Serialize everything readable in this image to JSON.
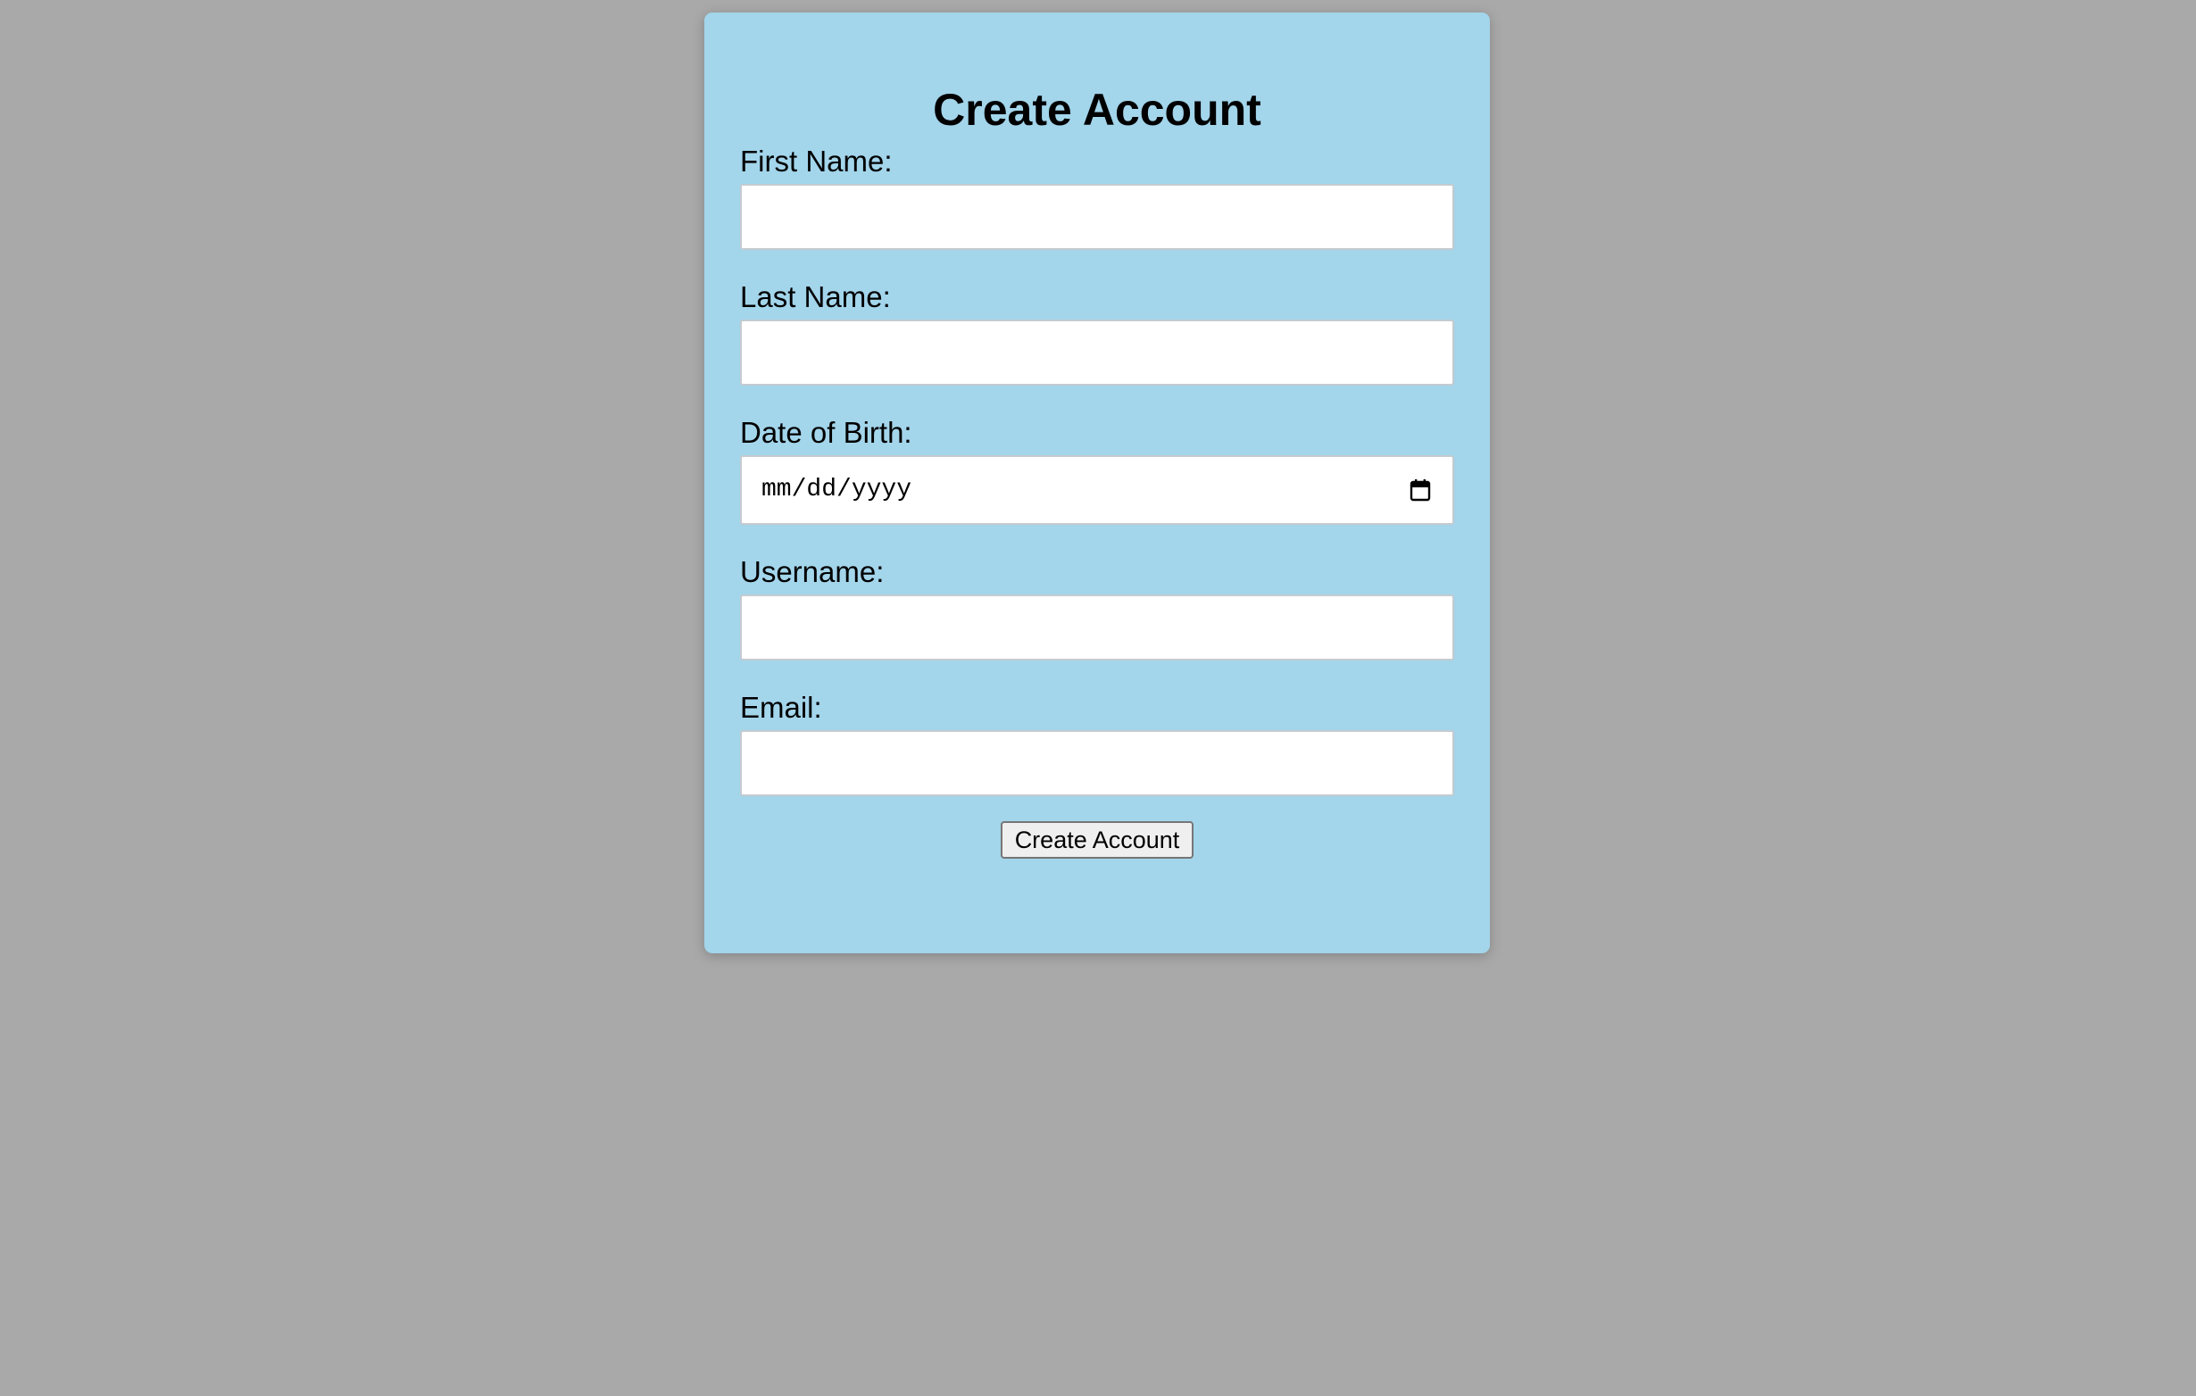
{
  "form": {
    "title": "Create Account",
    "fields": [
      {
        "label": "First Name:",
        "value": "",
        "placeholder": ""
      },
      {
        "label": "Last Name:",
        "value": "",
        "placeholder": ""
      },
      {
        "label": "Date of Birth:",
        "value": "mm/dd/yyyy",
        "icon": "calendar-icon"
      },
      {
        "label": "Username:",
        "value": "",
        "placeholder": ""
      },
      {
        "label": "Email:",
        "value": "",
        "placeholder": ""
      }
    ],
    "submit_label": "Create Account"
  },
  "colors": {
    "page_background": "#a9a9a9",
    "card_background": "#a3d5eb"
  }
}
